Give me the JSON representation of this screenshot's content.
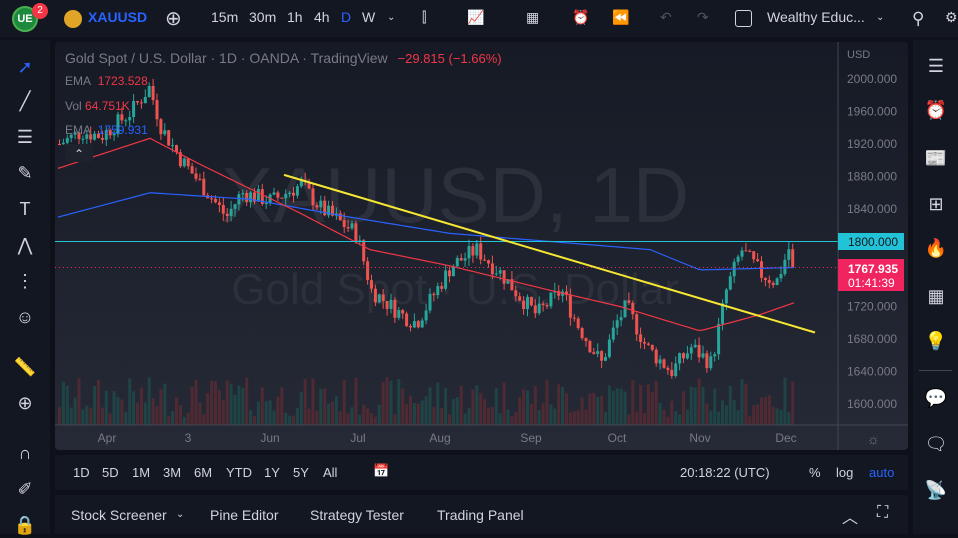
{
  "toolbar": {
    "notifications": "2",
    "symbol": "XAUUSD",
    "intervals": [
      "15m",
      "30m",
      "1h",
      "4h",
      "D",
      "W"
    ],
    "active_interval": "D",
    "layout_name": "Wealthy Educ..."
  },
  "legend": {
    "title": "Gold Spot / U.S. Dollar · 1D · OANDA · TradingView",
    "change": "−29.815 (−1.66%)",
    "ema1_label": "EMA",
    "ema1_value": "1723.528",
    "vol_label": "Vol",
    "vol_value": "64.751K",
    "ema2_label": "EMA",
    "ema2_value": "1759.931"
  },
  "watermark": {
    "symbol": "XAUUSD, 1D",
    "name": "Gold Spot · U.S. Dollar"
  },
  "price_axis": {
    "currency": "USD",
    "ticks": [
      "2000.000",
      "1960.000",
      "1920.000",
      "1880.000",
      "1840.000",
      "1800.000",
      "1720.000",
      "1680.000",
      "1640.000",
      "1600.000"
    ],
    "hline_label": "1800.000",
    "last_price": "1767.935",
    "countdown": "01:41:39"
  },
  "time_axis": {
    "labels": [
      "Apr",
      "3",
      "Jun",
      "Jul",
      "Aug",
      "Sep",
      "Oct",
      "Nov",
      "Dec"
    ]
  },
  "range_bar": {
    "ranges": [
      "1D",
      "5D",
      "1M",
      "3M",
      "6M",
      "YTD",
      "1Y",
      "5Y",
      "All"
    ],
    "time": "20:18:22 (UTC)",
    "percent": "%",
    "log": "log",
    "auto": "auto"
  },
  "bottom_panel": {
    "tabs": [
      "Stock Screener",
      "Pine Editor",
      "Strategy Tester",
      "Trading Panel"
    ]
  },
  "colors": {
    "up": "#26a69a",
    "down": "#ef5350",
    "ema_red": "#f23645",
    "ema_blue": "#2962ff",
    "trend": "#f7e733",
    "hline": "#22c3d6",
    "last": "#f0245e"
  },
  "chart_data": {
    "type": "candlestick",
    "price_path": [
      [
        0,
        1920
      ],
      [
        22,
        1935
      ],
      [
        42,
        1930
      ],
      [
        72,
        1960
      ],
      [
        90,
        1990
      ],
      [
        102,
        1940
      ],
      [
        122,
        1900
      ],
      [
        142,
        1870
      ],
      [
        167,
        1830
      ],
      [
        182,
        1860
      ],
      [
        212,
        1850
      ],
      [
        242,
        1870
      ],
      [
        262,
        1840
      ],
      [
        297,
        1810
      ],
      [
        312,
        1740
      ],
      [
        342,
        1710
      ],
      [
        357,
        1700
      ],
      [
        372,
        1730
      ],
      [
        392,
        1770
      ],
      [
        417,
        1790
      ],
      [
        442,
        1760
      ],
      [
        462,
        1730
      ],
      [
        477,
        1710
      ],
      [
        502,
        1740
      ],
      [
        517,
        1700
      ],
      [
        542,
        1650
      ],
      [
        557,
        1700
      ],
      [
        567,
        1720
      ],
      [
        587,
        1670
      ],
      [
        612,
        1640
      ],
      [
        632,
        1670
      ],
      [
        652,
        1650
      ],
      [
        667,
        1740
      ],
      [
        682,
        1790
      ],
      [
        702,
        1760
      ],
      [
        717,
        1750
      ],
      [
        732,
        1800
      ],
      [
        737,
        1768
      ]
    ],
    "ema_red": [
      [
        0,
        1890
      ],
      [
        92,
        1927
      ],
      [
        142,
        1895
      ],
      [
        242,
        1835
      ],
      [
        312,
        1790
      ],
      [
        392,
        1770
      ],
      [
        492,
        1740
      ],
      [
        562,
        1720
      ],
      [
        642,
        1690
      ],
      [
        702,
        1710
      ],
      [
        737,
        1725
      ]
    ],
    "ema_blue": [
      [
        0,
        1830
      ],
      [
        92,
        1860
      ],
      [
        192,
        1852
      ],
      [
        292,
        1830
      ],
      [
        392,
        1810
      ],
      [
        492,
        1800
      ],
      [
        592,
        1790
      ],
      [
        642,
        1765
      ],
      [
        737,
        1768
      ]
    ],
    "trendline": [
      [
        226,
        1882
      ],
      [
        757,
        1688
      ]
    ],
    "hline": 1800,
    "last": 1767.935,
    "ylim": [
      1570,
      2045
    ]
  }
}
